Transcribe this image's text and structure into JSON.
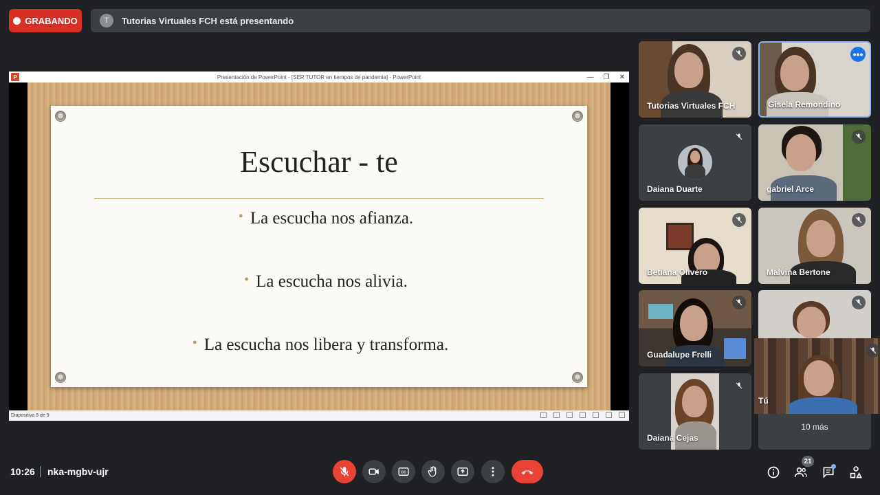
{
  "recording": {
    "label": "GRABANDO"
  },
  "presenting": {
    "avatar_letter": "T",
    "text": "Tutorias Virtuales FCH está presentando"
  },
  "powerpoint": {
    "logo": "P",
    "window_title": "Presentación de PowerPoint - [SER TUTOR en tiempos de pandemia] - PowerPoint",
    "slide_title": "Escuchar - te",
    "bullets": [
      "La escucha nos afianza.",
      "La escucha  nos alivia.",
      "La escucha nos libera y transforma."
    ],
    "status": "Diapositiva 8 de 9"
  },
  "participants": [
    {
      "name": "Tutorias Virtuales FCH",
      "muted": true
    },
    {
      "name": "Gisela Remondino",
      "muted": false
    },
    {
      "name": "Daiana Duarte",
      "muted": true
    },
    {
      "name": "gabriel Arce",
      "muted": true
    },
    {
      "name": "Betiana Olivero",
      "muted": true
    },
    {
      "name": "Malvina Bertone",
      "muted": true
    },
    {
      "name": "Guadalupe Frelli",
      "muted": true
    },
    {
      "name": "Daiana Cejas",
      "muted": true
    }
  ],
  "more_tile": {
    "label": "10 más"
  },
  "self_tile": {
    "label": "Tú"
  },
  "footer": {
    "time": "10:26",
    "meeting_code": "nka-mgbv-ujr",
    "participant_count": "21"
  },
  "colors": {
    "record_red": "#d93025",
    "hangup_red": "#ea4335",
    "active_border": "#8ab4f8",
    "meet_bg": "#202124",
    "tile_bg": "#3c4043"
  },
  "icons": [
    "mic-off-icon",
    "camera-icon",
    "captions-icon",
    "raise-hand-icon",
    "present-icon",
    "more-options-icon",
    "hang-up-icon",
    "info-icon",
    "people-icon",
    "chat-icon",
    "activities-icon"
  ]
}
